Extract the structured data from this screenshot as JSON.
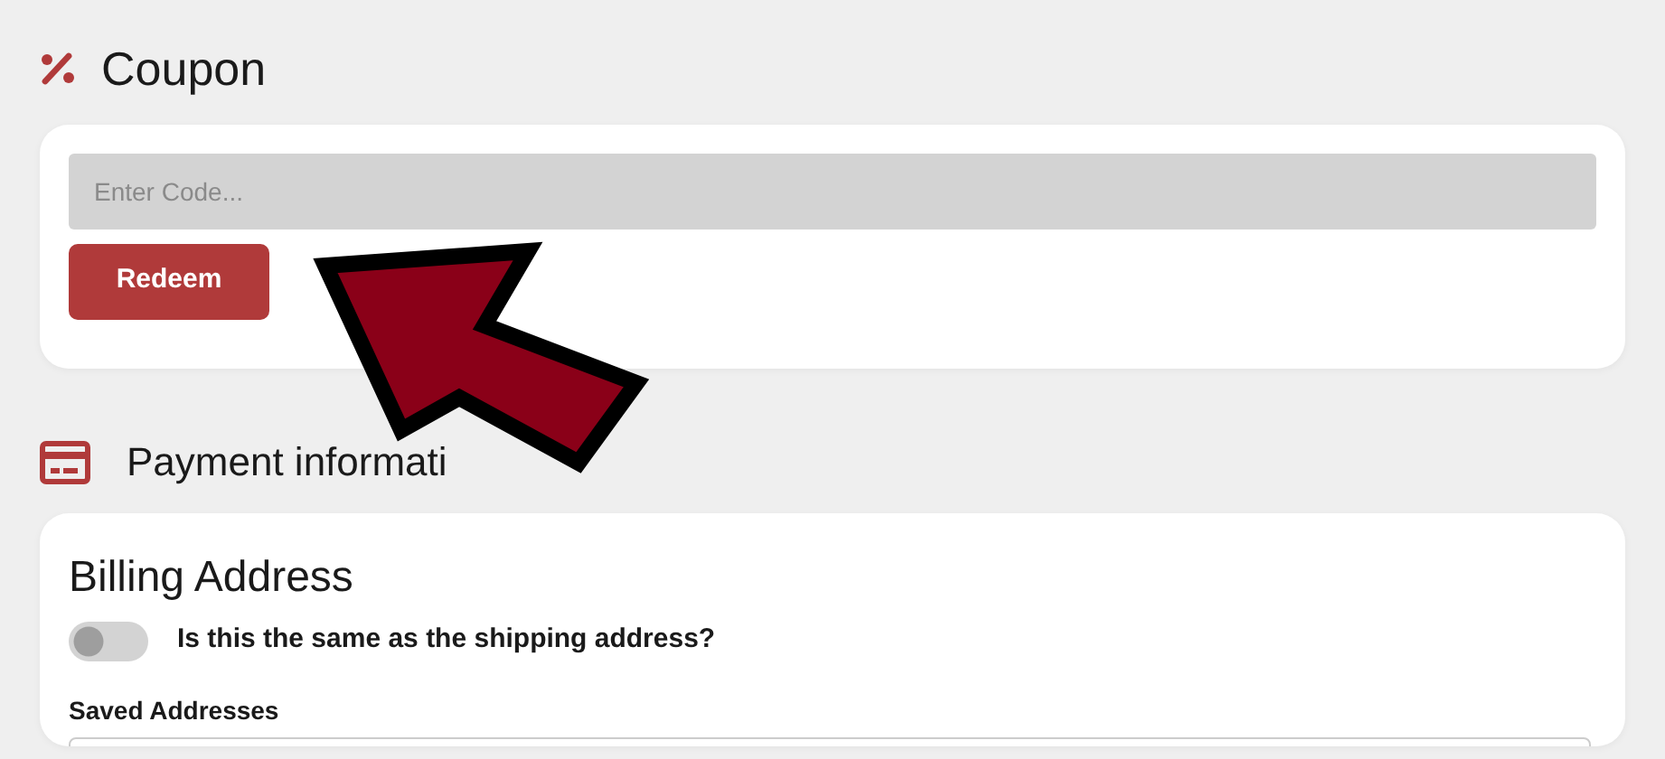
{
  "coupon": {
    "title": "Coupon",
    "code_field": {
      "placeholder": "Enter Code..."
    },
    "redeem_button": "Redeem"
  },
  "payment": {
    "title": "Payment informati",
    "billing": {
      "title": "Billing Address",
      "same_as_shipping": {
        "label": "Is this the same as the shipping address?",
        "on": false
      },
      "saved_addresses": {
        "label": "Saved Addresses"
      }
    }
  }
}
